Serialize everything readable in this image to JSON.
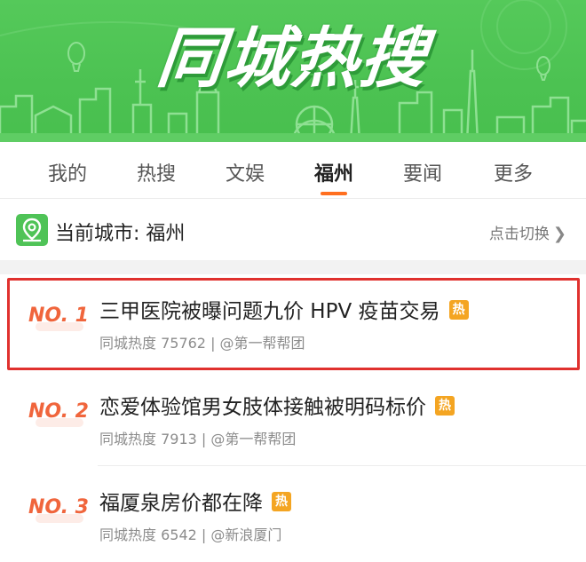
{
  "banner": {
    "title": "同城热搜"
  },
  "tabs": [
    {
      "label": "我的"
    },
    {
      "label": "热搜"
    },
    {
      "label": "文娱"
    },
    {
      "label": "福州",
      "active": true
    },
    {
      "label": "要闻"
    },
    {
      "label": "更多"
    }
  ],
  "city": {
    "label": "当前城市: 福州",
    "switch_label": "点击切换",
    "icon": "location-pin-icon",
    "chevron": ">"
  },
  "list": [
    {
      "rank": "NO. 1",
      "title": "三甲医院被曝问题九价 HPV 疫苗交易",
      "badge": "热",
      "meta": "同城热度 75762 | @第一帮帮团",
      "highlighted": true
    },
    {
      "rank": "NO. 2",
      "title": "恋爱体验馆男女肢体接触被明码标价",
      "badge": "热",
      "meta": "同城热度 7913 | @第一帮帮团"
    },
    {
      "rank": "NO. 3",
      "title": "福厦泉房价都在降",
      "badge": "热",
      "meta": "同城热度 6542 | @新浪厦门"
    }
  ],
  "colors": {
    "banner_green": "#4cc252",
    "accent_orange": "#ff6f1f",
    "rank_color": "#f0653c",
    "hot_badge": "#f4a522",
    "highlight_frame": "#e0312e"
  }
}
